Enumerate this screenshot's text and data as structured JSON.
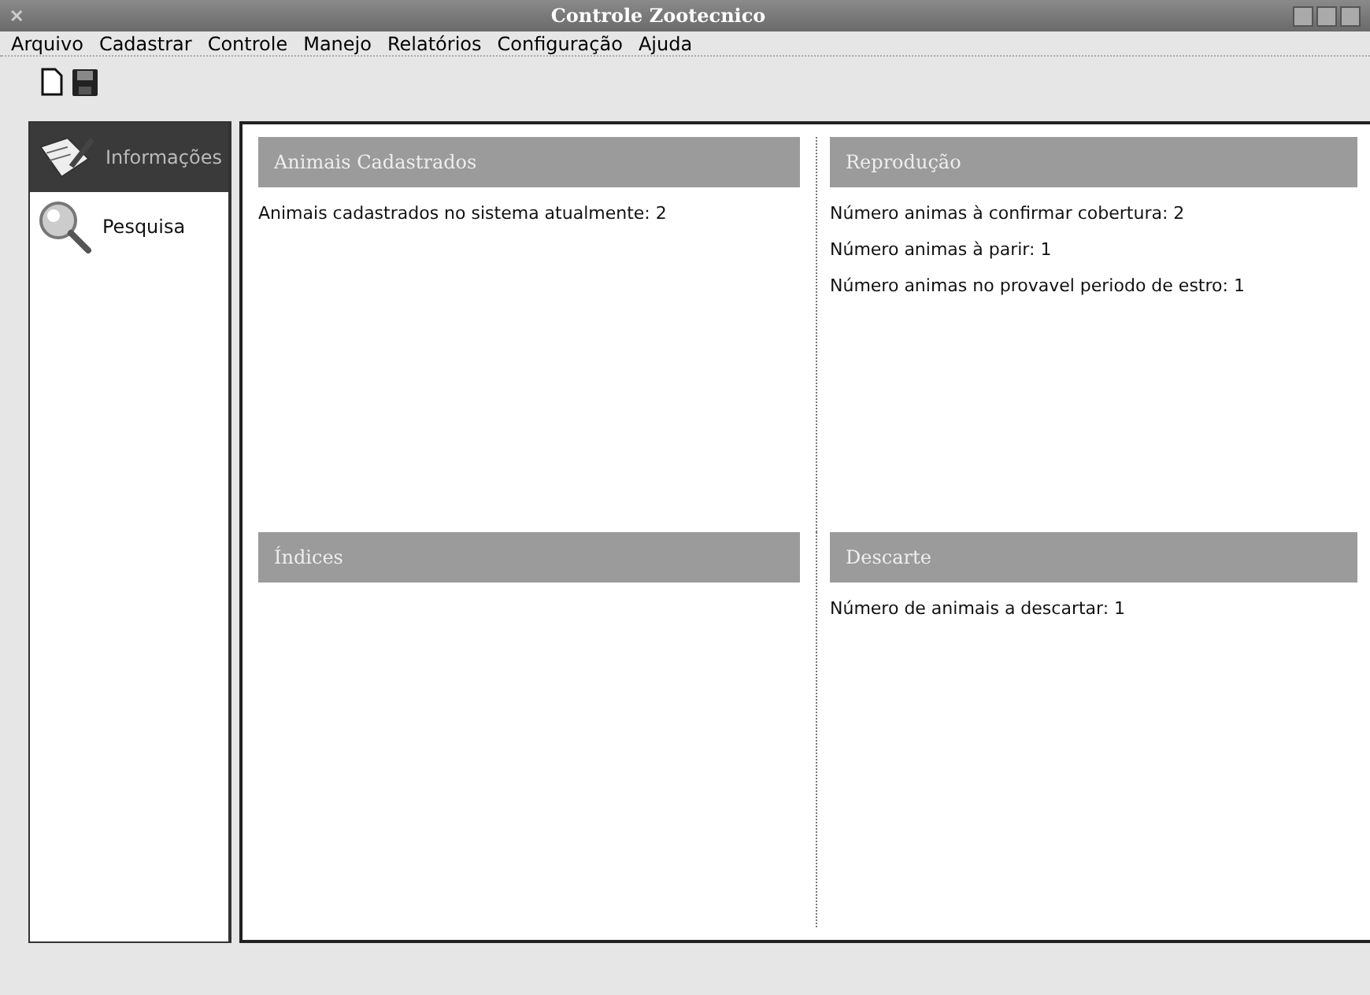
{
  "window": {
    "title": "Controle Zootecnico",
    "close_glyph": "✕"
  },
  "menu": [
    "Arquivo",
    "Cadastrar",
    "Controle",
    "Manejo",
    "Relatórios",
    "Configuração",
    "Ajuda"
  ],
  "toolbar": [
    {
      "kind": "new"
    },
    {
      "kind": "save"
    }
  ],
  "sidebar": {
    "items": [
      {
        "label": "Informações",
        "kind": "info",
        "selected": true
      },
      {
        "label": "Pesquisa",
        "kind": "search",
        "selected": false
      }
    ]
  },
  "panels": [
    {
      "title": "Animais Cadastrados",
      "lines": [
        "Animais cadastrados no sistema atualmente: 2"
      ]
    },
    {
      "title": "Reprodução",
      "lines": [
        "Número animas à confirmar cobertura: 2",
        "Número animas à parir: 1",
        "Número animas no provavel periodo de estro: 1"
      ]
    },
    {
      "title": "Índices"
    },
    {
      "title": "Descarte",
      "lines": [
        "Número de animais a descartar: 1"
      ]
    }
  ]
}
